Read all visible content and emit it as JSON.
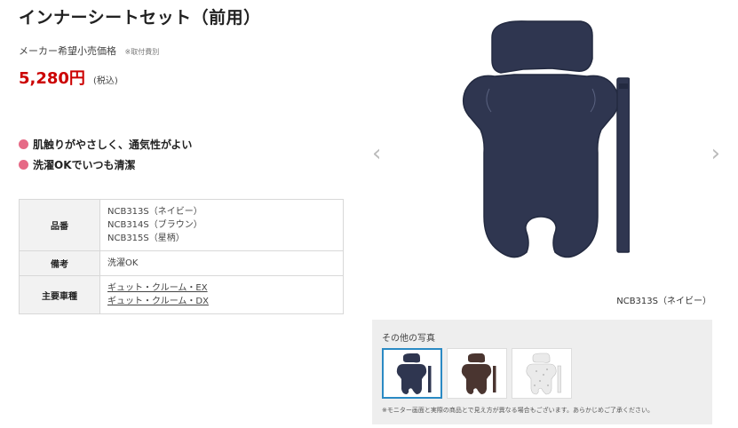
{
  "product": {
    "title": "インナーシートセット（前用）",
    "msrp_label": "メーカー希望小売価格",
    "msrp_note": "※取付費別",
    "price": "5,280円",
    "tax_label": "(税込)"
  },
  "features": [
    "肌触りがやさしく、通気性がよい",
    "洗濯OKでいつも清潔"
  ],
  "spec": {
    "part_number_label": "品番",
    "part_numbers": [
      "NCB313S（ネイビー）",
      "NCB314S（ブラウン）",
      "NCB315S（星柄）"
    ],
    "remarks_label": "備考",
    "remarks_value": "洗濯OK",
    "vehicles_label": "主要車種",
    "vehicles": [
      "ギュット・クルーム・EX",
      "ギュット・クルーム・DX"
    ]
  },
  "gallery": {
    "prev_icon": "chevron-left-icon",
    "next_icon": "chevron-right-icon",
    "caption": "NCB313S（ネイビー）",
    "colors": {
      "navy": "#2f3650",
      "brown": "#4a3530",
      "star": "#d8d8d8"
    }
  },
  "others": {
    "label": "その他の写真",
    "note": "※モニター画面と実際の商品とで見え方が異なる場合もございます。あらかじめご了承ください。"
  }
}
